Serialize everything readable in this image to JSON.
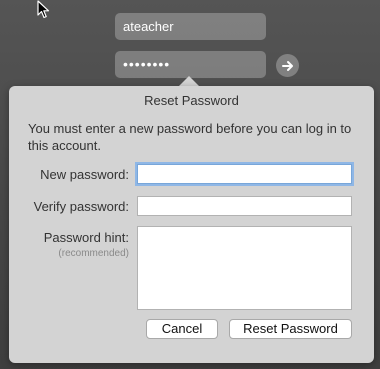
{
  "login": {
    "username": "ateacher",
    "password_masked": "••••••••"
  },
  "dialog": {
    "title": "Reset Password",
    "message": "You must enter a new password before you can log in to this account.",
    "new_password_label": "New password:",
    "verify_password_label": "Verify password:",
    "hint_label": "Password hint:",
    "hint_sublabel": "(recommended)",
    "new_password_value": "",
    "verify_password_value": "",
    "hint_value": "",
    "cancel_label": "Cancel",
    "reset_label": "Reset Password"
  },
  "icons": {
    "cursor": "arrow-cursor-icon",
    "go": "arrow-right-icon"
  },
  "colors": {
    "background": "#4c4c4c",
    "dialog": "#d3d3d3",
    "focus_ring": "#8fb7e6"
  }
}
